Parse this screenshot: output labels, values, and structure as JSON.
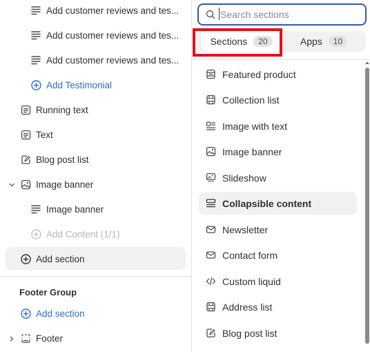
{
  "left_panel": {
    "items": [
      {
        "label": "Add customer reviews and tes...",
        "icon": "text-lines-icon"
      },
      {
        "label": "Add customer reviews and tes...",
        "icon": "text-lines-icon"
      },
      {
        "label": "Add customer reviews and tes...",
        "icon": "text-lines-icon"
      },
      {
        "label": "Add Testimonial",
        "icon": "plus-circle-icon"
      },
      {
        "label": "Running text",
        "icon": "text-block-icon"
      },
      {
        "label": "Text",
        "icon": "text-block-icon"
      },
      {
        "label": "Blog post list",
        "icon": "blog-edit-icon"
      },
      {
        "label": "Image banner",
        "icon": "image-icon",
        "expanded": true
      },
      {
        "label": "Image banner",
        "icon": "text-lines-icon"
      },
      {
        "label": "Add Content (1/1)",
        "icon": "plus-circle-icon",
        "disabled": true
      },
      {
        "label": "Add section",
        "icon": "plus-circle-icon",
        "active": true
      }
    ],
    "footer_group": {
      "title": "Footer Group",
      "add_section_label": "Add section",
      "footer_label": "Footer"
    }
  },
  "picker": {
    "search": {
      "placeholder": "Search sections",
      "value": ""
    },
    "tabs": [
      {
        "label": "Sections",
        "count": "20",
        "selected": true
      },
      {
        "label": "Apps",
        "count": "10",
        "selected": false
      }
    ],
    "sections": [
      {
        "label": "Featured product",
        "icon": "product-icon"
      },
      {
        "label": "Collection list",
        "icon": "collection-icon"
      },
      {
        "label": "Image with text",
        "icon": "image-with-text-icon"
      },
      {
        "label": "Image banner",
        "icon": "image-icon"
      },
      {
        "label": "Slideshow",
        "icon": "slideshow-icon"
      },
      {
        "label": "Collapsible content",
        "icon": "collapsible-icon",
        "active": true
      },
      {
        "label": "Newsletter",
        "icon": "email-icon"
      },
      {
        "label": "Contact form",
        "icon": "email-form-icon"
      },
      {
        "label": "Custom liquid",
        "icon": "code-icon"
      },
      {
        "label": "Address list",
        "icon": "list-icon"
      },
      {
        "label": "Blog post list",
        "icon": "blog-edit-icon"
      }
    ]
  },
  "colors": {
    "accent": "#2c6ecb",
    "highlight": "#e3111b",
    "search_border": "#2e5aac"
  }
}
